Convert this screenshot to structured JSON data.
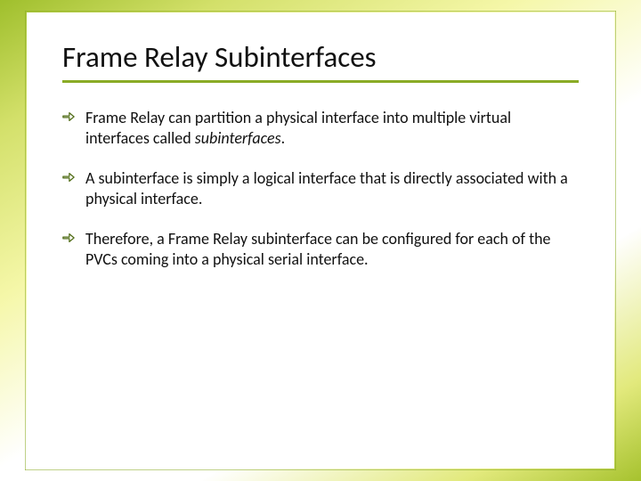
{
  "slide": {
    "title": "Frame Relay Subinterfaces",
    "bullets": [
      {
        "pre": "Frame Relay can partition a physical interface into multiple virtual interfaces called ",
        "em": "subinterfaces",
        "post": "."
      },
      {
        "pre": "A subinterface is simply a logical interface that is directly associated with a physical interface.",
        "em": "",
        "post": ""
      },
      {
        "pre": "Therefore, a Frame Relay subinterface can be configured for each of the PVCs coming into a physical serial interface.",
        "em": "",
        "post": ""
      }
    ]
  }
}
